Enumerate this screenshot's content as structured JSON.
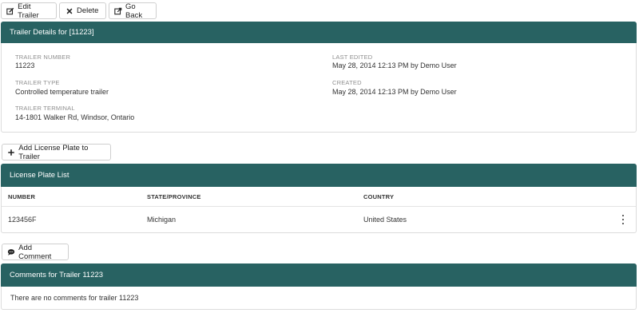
{
  "toolbar": {
    "edit_label": "Edit Trailer",
    "delete_label": "Delete",
    "back_label": "Go Back"
  },
  "details": {
    "title": "Trailer Details for [11223]",
    "trailer_number_label": "TRAILER NUMBER",
    "trailer_number": "11223",
    "trailer_type_label": "TRAILER TYPE",
    "trailer_type": "Controlled temperature trailer",
    "trailer_terminal_label": "TRAILER TERMINAL",
    "trailer_terminal": "14-1801 Walker Rd, Windsor, Ontario",
    "last_edited_label": "LAST EDITED",
    "last_edited": "May 28, 2014 12:13 PM by Demo User",
    "created_label": "CREATED",
    "created": "May 28, 2014 12:13 PM by Demo User"
  },
  "plates": {
    "add_label": "Add License Plate to Trailer",
    "title": "License Plate List",
    "columns": [
      "NUMBER",
      "STATE/PROVINCE",
      "COUNTRY"
    ],
    "rows": [
      {
        "number": "123456F",
        "state": "Michigan",
        "country": "United States"
      }
    ]
  },
  "comments": {
    "add_label": "Add Comment",
    "title": "Comments for Trailer 11223",
    "empty_text": "There are no comments for trailer 11223"
  },
  "colors": {
    "header_bg": "#286262",
    "header_text": "#ffffff"
  },
  "icons": {
    "edit": "pencil-square-icon",
    "delete": "x-icon",
    "back": "external-link-icon",
    "add": "plus-icon",
    "comment": "speech-bubble-icon",
    "menu": "kebab-icon"
  }
}
